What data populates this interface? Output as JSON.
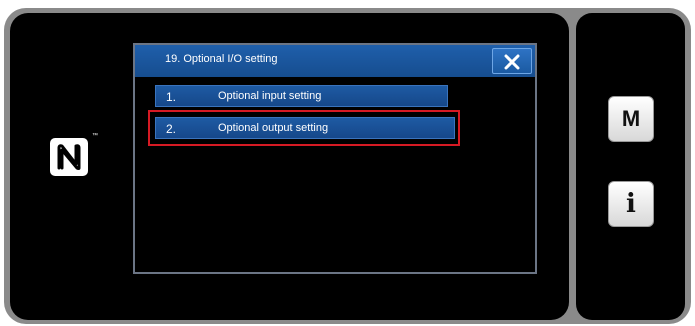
{
  "dialog": {
    "title": "19. Optional I/O setting",
    "items": [
      {
        "number": "1.",
        "label": "Optional input setting"
      },
      {
        "number": "2.",
        "label": "Optional output setting"
      }
    ]
  },
  "side_buttons": {
    "menu_label": "M",
    "info_label": "i"
  },
  "nfc": {
    "trademark": "™"
  },
  "icons": {
    "close": "close-icon",
    "nfc": "nfc-icon"
  },
  "colors": {
    "titlebar": "#1f5fab",
    "button": "#1e5aa3",
    "highlight": "#d61a24"
  }
}
